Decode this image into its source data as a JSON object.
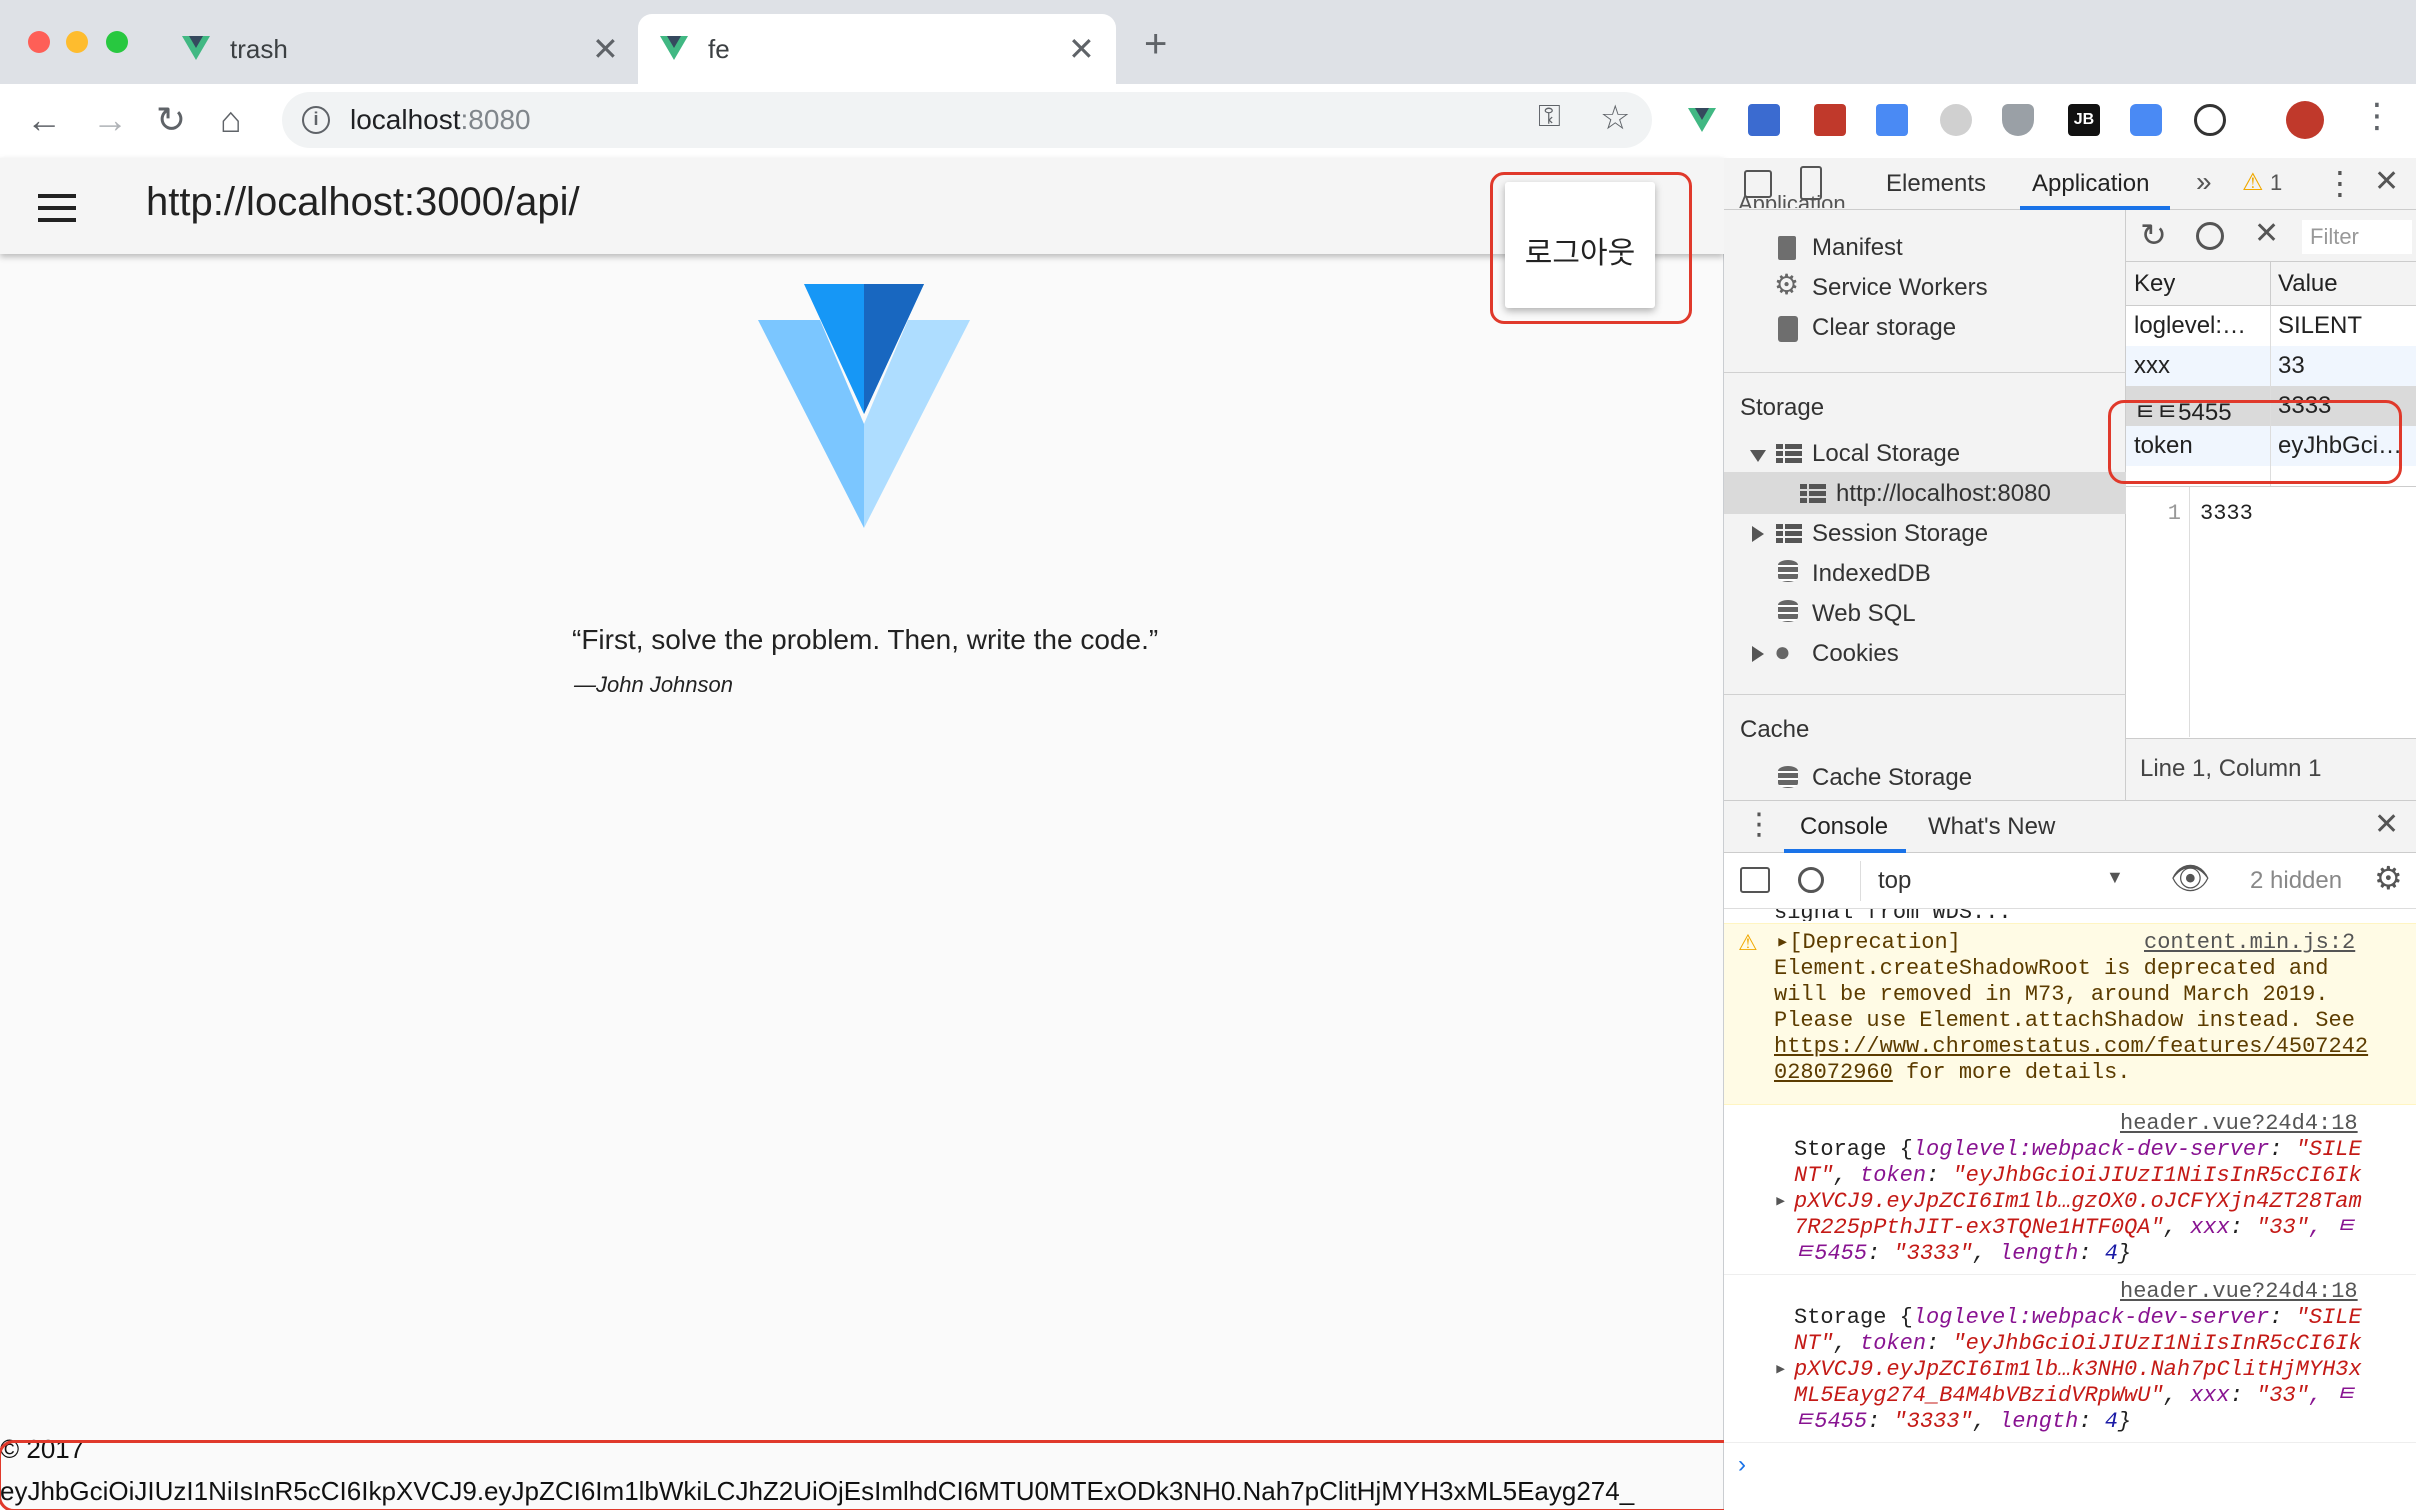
{
  "browser": {
    "tabs": [
      {
        "title": "trash",
        "active": false
      },
      {
        "title": "fe",
        "active": true
      }
    ],
    "new_tab_label": "+",
    "url_host": "localhost",
    "url_port": ":8080"
  },
  "app": {
    "header_title": "http://localhost:3000/api/",
    "logout_label": "로그아웃",
    "quote": "“First, solve the problem. Then, write the code.”",
    "quote_author": "—John Johnson",
    "footer_copyright": "© 2017",
    "footer_token": "eyJhbGciOiJIUzI1NiIsInR5cCI6IkpXVCJ9.eyJpZCI6Im1lbWkiLCJhZ2UiOjEsImlhdCI6MTU0MTExODk3NH0.Nah7pClitHjMYH3xML5Eayg274_"
  },
  "devtools": {
    "tabs": [
      "Elements",
      "Application"
    ],
    "active_tab": "Application",
    "warn_count": "1",
    "clipped_heading": "Application",
    "app_items": [
      "Manifest",
      "Service Workers",
      "Clear storage"
    ],
    "storage_heading": "Storage",
    "local_storage": "Local Storage",
    "local_origin": "http://localhost:8080",
    "storage_items": [
      "Session Storage",
      "IndexedDB",
      "Web SQL",
      "Cookies"
    ],
    "cache_heading": "Cache",
    "cache_items": [
      "Cache Storage"
    ],
    "filter_placeholder": "Filter",
    "table_headers": [
      "Key",
      "Value"
    ],
    "rows": [
      {
        "key": "loglevel:…",
        "value": "SILENT"
      },
      {
        "key": "xxx",
        "value": "33"
      },
      {
        "key": "ㅌㅌ5455",
        "value": "3333"
      },
      {
        "key": "token",
        "value": "eyJhbGci…"
      }
    ],
    "preview_line_no": "1",
    "preview_value": "3333",
    "status": "Line 1, Column 1",
    "drawer_tabs": [
      "Console",
      "What's New"
    ],
    "context": "top",
    "hidden_count": "2 hidden",
    "console": {
      "clipped_line": "signal from WDS...",
      "deprecation_head": "[Deprecation]",
      "deprecation_src": "content.min.js:2",
      "deprecation_lines": [
        "Element.createShadowRoot is deprecated and",
        "will be removed in M73, around March 2019.",
        "Please use Element.attachShadow instead. See"
      ],
      "deprecation_link_1": "https://www.chromestatus.com/features/4507242",
      "deprecation_link_2": "028072960",
      "deprecation_tail": " for more details.",
      "logs": [
        {
          "src": "header.vue?24d4:18",
          "l1a": "Storage {",
          "l1b": "loglevel:webpack-dev-server",
          "l1c": ": ",
          "l1d": "\"SILE",
          "l2a": "NT\"",
          "l2b": ", ",
          "l2c": "token",
          "l2d": ": ",
          "l2e": "\"eyJhbGciOiJIUzI1NiIsInR5cCI6Ik",
          "l3": "pXVCJ9.eyJpZCI6Im1lb…gzOX0.oJCFYXjn4ZT28Tam",
          "l4a": "7R225pPthJIT-ex3TQNe1HTF0QA\"",
          "l4b": ", ",
          "l4c": "xxx",
          "l4d": ": ",
          "l4e": "\"33\"",
          "l4f": ", ㅌ",
          "l5a": "ㅌ5455",
          "l5b": ": ",
          "l5c": "\"3333\"",
          "l5d": ", ",
          "l5e": "length",
          "l5f": ": ",
          "l5g": "4",
          "l5h": "}"
        },
        {
          "src": "header.vue?24d4:18",
          "l1a": "Storage {",
          "l1b": "loglevel:webpack-dev-server",
          "l1c": ": ",
          "l1d": "\"SILE",
          "l2a": "NT\"",
          "l2b": ", ",
          "l2c": "token",
          "l2d": ": ",
          "l2e": "\"eyJhbGciOiJIUzI1NiIsInR5cCI6Ik",
          "l3": "pXVCJ9.eyJpZCI6Im1lb…k3NH0.Nah7pClitHjMYH3x",
          "l4a": "ML5Eayg274_B4M4bVBzidVRpWwU\"",
          "l4b": ", ",
          "l4c": "xxx",
          "l4d": ": ",
          "l4e": "\"33\"",
          "l4f": ", ㅌ",
          "l5a": "ㅌ5455",
          "l5b": ": ",
          "l5c": "\"3333\"",
          "l5d": ", ",
          "l5e": "length",
          "l5f": ": ",
          "l5g": "4",
          "l5h": "}"
        }
      ]
    }
  },
  "colors": {
    "annotation_red": "#e0392b",
    "devtools_blue": "#1a73e8",
    "vue_green": "#41b883",
    "vuetify_blue": "#1867c0"
  }
}
